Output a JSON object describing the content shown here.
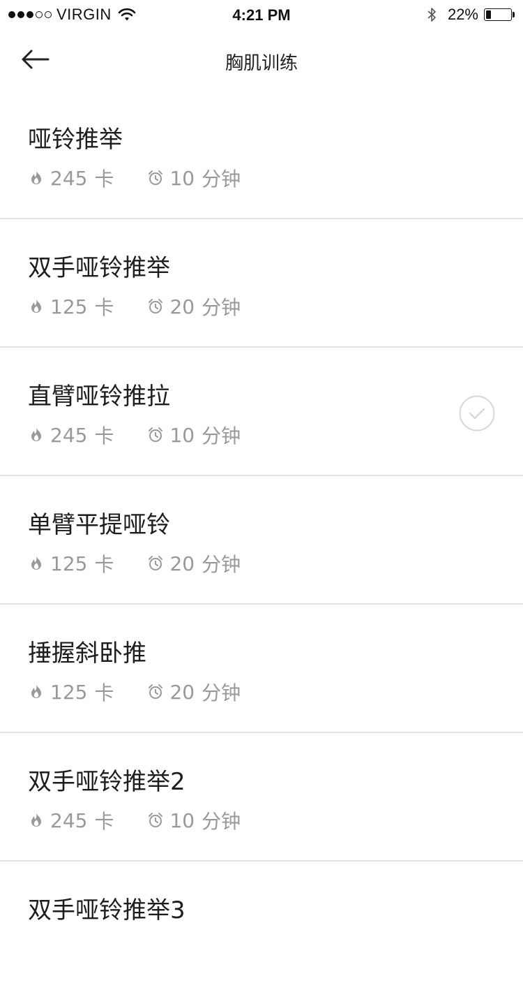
{
  "status_bar": {
    "carrier": "VIRGIN",
    "time": "4:21 PM",
    "battery_percent_label": "22%",
    "battery_level": 0.22,
    "signal_bars_filled": 3,
    "signal_bars_total": 5
  },
  "nav": {
    "title": "胸肌训练",
    "back_icon": "arrow-left-icon"
  },
  "colors": {
    "text_primary": "#1d1d1d",
    "text_secondary": "#999999",
    "divider": "#e3e3e3",
    "check": "#d8d8d8"
  },
  "exercises": [
    {
      "name": "哑铃推举",
      "calories": "245",
      "calorie_unit": "卡",
      "duration": "10",
      "duration_unit": "分钟",
      "completed": false
    },
    {
      "name": "双手哑铃推举",
      "calories": "125",
      "calorie_unit": "卡",
      "duration": "20",
      "duration_unit": "分钟",
      "completed": false
    },
    {
      "name": "直臂哑铃推拉",
      "calories": "245",
      "calorie_unit": "卡",
      "duration": "10",
      "duration_unit": "分钟",
      "completed": true
    },
    {
      "name": "单臂平提哑铃",
      "calories": "125",
      "calorie_unit": "卡",
      "duration": "20",
      "duration_unit": "分钟",
      "completed": false
    },
    {
      "name": "捶握斜卧推",
      "calories": "125",
      "calorie_unit": "卡",
      "duration": "20",
      "duration_unit": "分钟",
      "completed": false
    },
    {
      "name": "双手哑铃推举2",
      "calories": "245",
      "calorie_unit": "卡",
      "duration": "10",
      "duration_unit": "分钟",
      "completed": false
    },
    {
      "name": "双手哑铃推举3",
      "calories": "",
      "calorie_unit": "",
      "duration": "",
      "duration_unit": "",
      "completed": false
    }
  ]
}
